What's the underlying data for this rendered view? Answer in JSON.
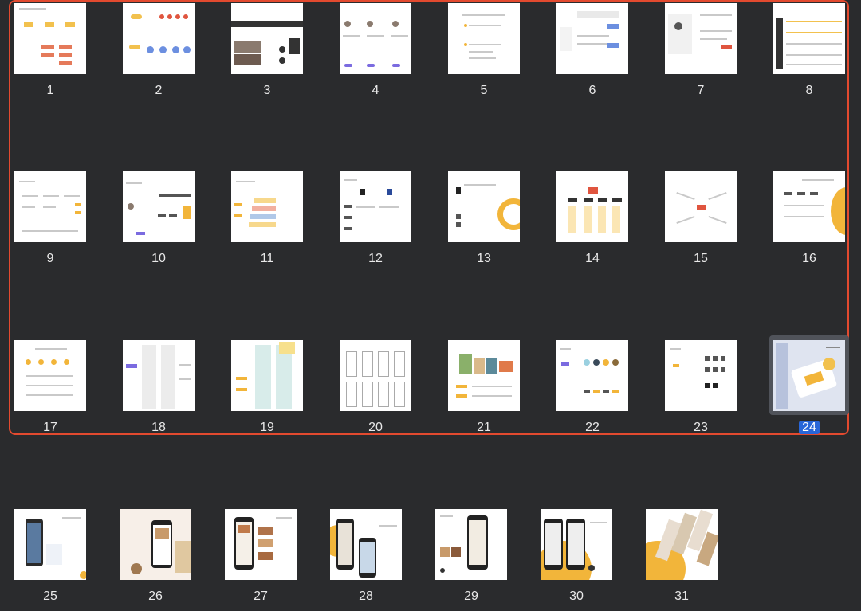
{
  "slides": [
    {
      "label": "1"
    },
    {
      "label": "2"
    },
    {
      "label": "3"
    },
    {
      "label": "4"
    },
    {
      "label": "5"
    },
    {
      "label": "6"
    },
    {
      "label": "7"
    },
    {
      "label": "8"
    },
    {
      "label": "9"
    },
    {
      "label": "10"
    },
    {
      "label": "11"
    },
    {
      "label": "12"
    },
    {
      "label": "13"
    },
    {
      "label": "14"
    },
    {
      "label": "15"
    },
    {
      "label": "16"
    },
    {
      "label": "17"
    },
    {
      "label": "18"
    },
    {
      "label": "19"
    },
    {
      "label": "20"
    },
    {
      "label": "21"
    },
    {
      "label": "22"
    },
    {
      "label": "23"
    },
    {
      "label": "24",
      "selected": true
    },
    {
      "label": "25"
    },
    {
      "label": "26"
    },
    {
      "label": "27"
    },
    {
      "label": "28"
    },
    {
      "label": "29"
    },
    {
      "label": "30"
    },
    {
      "label": "31"
    }
  ],
  "colors": {
    "background": "#2a2b2d",
    "selection_outline": "#e34a2f",
    "selected_badge": "#2866d8",
    "accent_yellow": "#f2b53a",
    "accent_red": "#e0553f",
    "accent_blue": "#6c8fe0"
  }
}
